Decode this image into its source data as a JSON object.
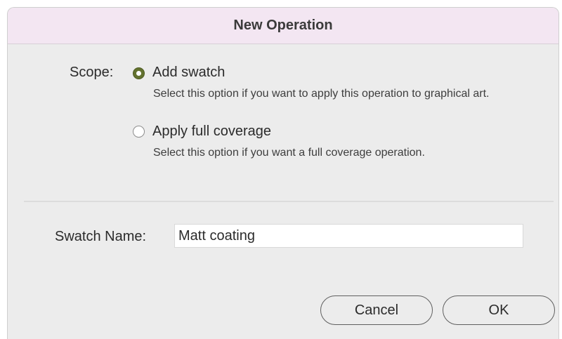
{
  "dialog": {
    "title": "New Operation"
  },
  "scope": {
    "label": "Scope:",
    "options": [
      {
        "label": "Add swatch",
        "description": "Select this option if you want to apply this operation to graphical art.",
        "selected": true
      },
      {
        "label": "Apply full coverage",
        "description": "Select this option if you want a full coverage operation.",
        "selected": false
      }
    ]
  },
  "swatch": {
    "label": "Swatch Name:",
    "value": "Matt coating"
  },
  "buttons": {
    "cancel_label": "Cancel",
    "ok_label": "OK"
  },
  "colors": {
    "titlebar_bg": "#f3e6f2",
    "dialog_bg": "#ececec",
    "radio_accent": "#63722f"
  }
}
